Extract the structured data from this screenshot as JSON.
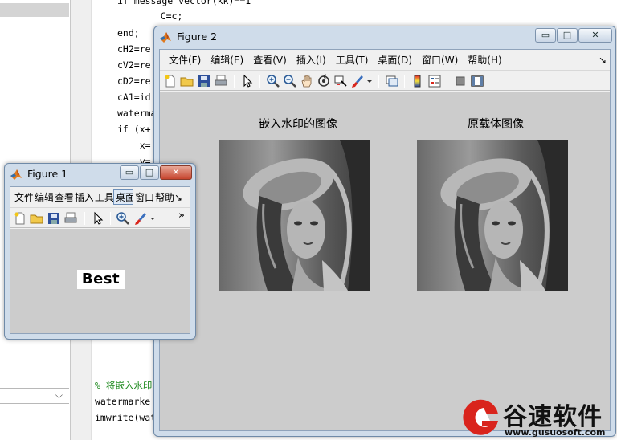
{
  "editor": {
    "code_lines": [
      "if message_vector(kk)==1",
      "    C=c;",
      "end;",
      "cH2=re",
      "cV2=re",
      "cD2=re",
      "cA1=id",
      "waterma",
      "if (x+",
      "    x=",
      "    y=",
      "% 将嵌入水印",
      "watermarke",
      "imwrite(wat"
    ],
    "left_combo_icon": "chevron-down-icon"
  },
  "figure2": {
    "title": "Figure 2",
    "menu": [
      "文件(F)",
      "编辑(E)",
      "查看(V)",
      "插入(I)",
      "工具(T)",
      "桌面(D)",
      "窗口(W)",
      "帮助(H)"
    ],
    "menu_overflow": "↘",
    "controls": {
      "minimize": "▭",
      "maximize": "□",
      "close": "✕"
    },
    "axes": [
      {
        "title": "嵌入水印的图像"
      },
      {
        "title": "原载体图像"
      }
    ]
  },
  "figure1": {
    "title": "Figure 1",
    "menu": [
      "文件",
      "编辑",
      "查看",
      "插入",
      "工具",
      "桌面",
      "窗口",
      "帮助"
    ],
    "menu_overflow": "↘",
    "toolbar_overflow": "»",
    "controls": {
      "minimize": "▭",
      "maximize": "□",
      "close": "✕"
    },
    "text": "Best"
  },
  "watermark": {
    "brand": "谷速软件",
    "url": "www.gusuosoft.com"
  },
  "colors": {
    "figure_bg": "#cccccc",
    "window_frame": "#cfdcea",
    "close_red": "#c6452e",
    "logo_red": "#d9241c",
    "comment_green": "#1e8a1e"
  }
}
